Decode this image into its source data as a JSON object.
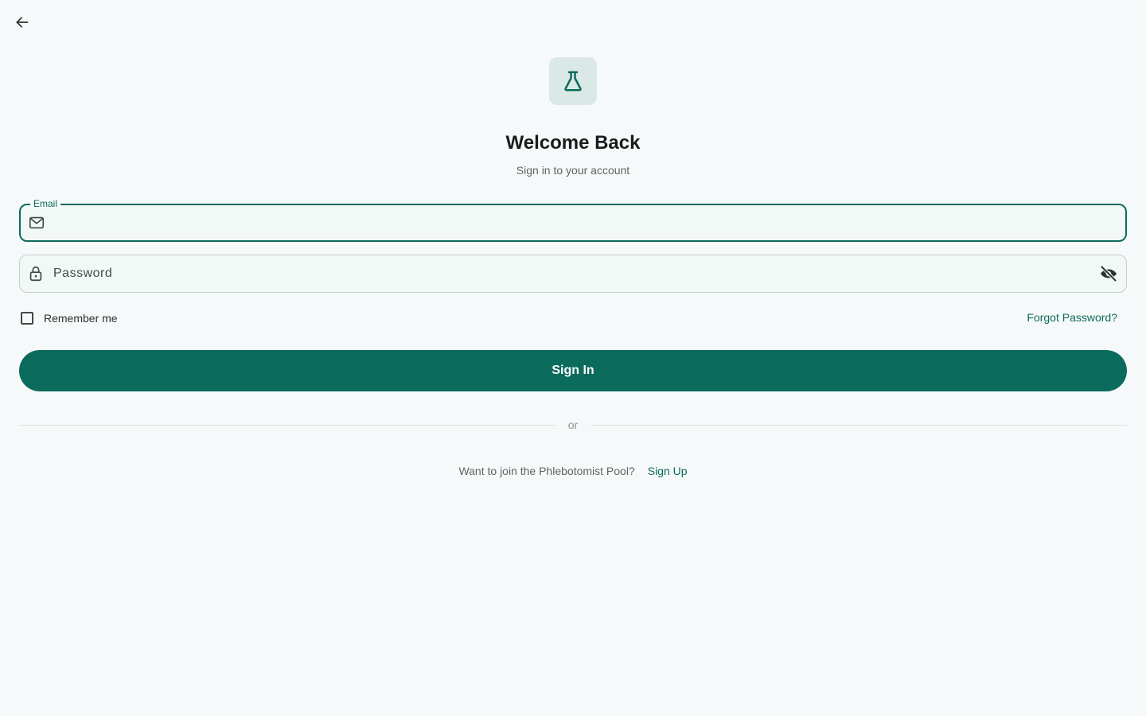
{
  "nav": {
    "back_icon": "arrow-left-icon"
  },
  "brand": {
    "logo_icon": "flask-icon",
    "accent_color": "#0b6b5c",
    "logo_bg_color": "#dbe9e6"
  },
  "header": {
    "title": "Welcome Back",
    "subtitle": "Sign in to your account"
  },
  "form": {
    "email": {
      "label": "Email",
      "value": "",
      "icon": "mail-icon"
    },
    "password": {
      "placeholder": "Password",
      "value": "",
      "icon": "lock-icon",
      "toggle_icon": "eye-off-icon"
    },
    "remember_label": "Remember me",
    "remember_checked": false,
    "forgot_label": "Forgot Password?",
    "submit_label": "Sign In"
  },
  "divider": {
    "text": "or"
  },
  "signup": {
    "prompt": "Want to join the Phlebotomist Pool?",
    "link_label": "Sign Up"
  }
}
